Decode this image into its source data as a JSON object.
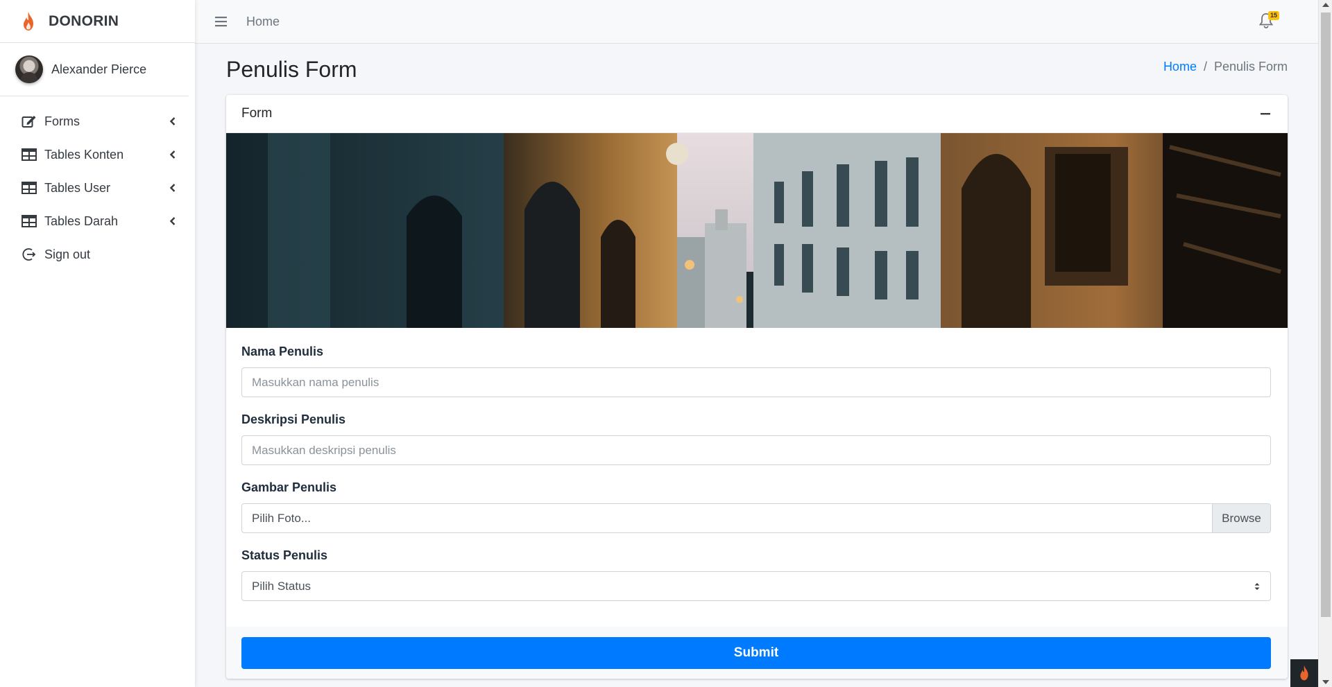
{
  "brand": {
    "name": "DONORIN",
    "logo_icon": "flame-icon",
    "accent": "#e8652c"
  },
  "user": {
    "name": "Alexander Pierce",
    "avatar_icon": "user-avatar"
  },
  "sidebar": {
    "items": [
      {
        "label": "Forms",
        "icon": "edit-icon",
        "has_submenu": true
      },
      {
        "label": "Tables Konten",
        "icon": "table-icon",
        "has_submenu": true
      },
      {
        "label": "Tables User",
        "icon": "table-icon",
        "has_submenu": true
      },
      {
        "label": "Tables Darah",
        "icon": "table-icon",
        "has_submenu": true
      },
      {
        "label": "Sign out",
        "icon": "sign-out-icon",
        "has_submenu": false
      }
    ]
  },
  "topbar": {
    "home_label": "Home",
    "notification_count": "15"
  },
  "header": {
    "title": "Penulis Form",
    "breadcrumb": {
      "home": "Home",
      "separator": "/",
      "current": "Penulis Form"
    }
  },
  "card": {
    "title": "Form",
    "banner_icon": "street-photo",
    "fields": {
      "nama": {
        "label": "Nama Penulis",
        "placeholder": "Masukkan nama penulis",
        "value": ""
      },
      "deskripsi": {
        "label": "Deskripsi Penulis",
        "placeholder": "Masukkan deskripsi penulis",
        "value": ""
      },
      "gambar": {
        "label": "Gambar Penulis",
        "file_text": "Pilih Foto...",
        "browse_label": "Browse"
      },
      "status": {
        "label": "Status Penulis",
        "selected": "Pilih Status"
      }
    },
    "submit_label": "Submit"
  },
  "colors": {
    "primary": "#007bff",
    "sidebar_bg": "#ffffff",
    "content_bg": "#f4f6f9",
    "badge": "#ffc107"
  }
}
